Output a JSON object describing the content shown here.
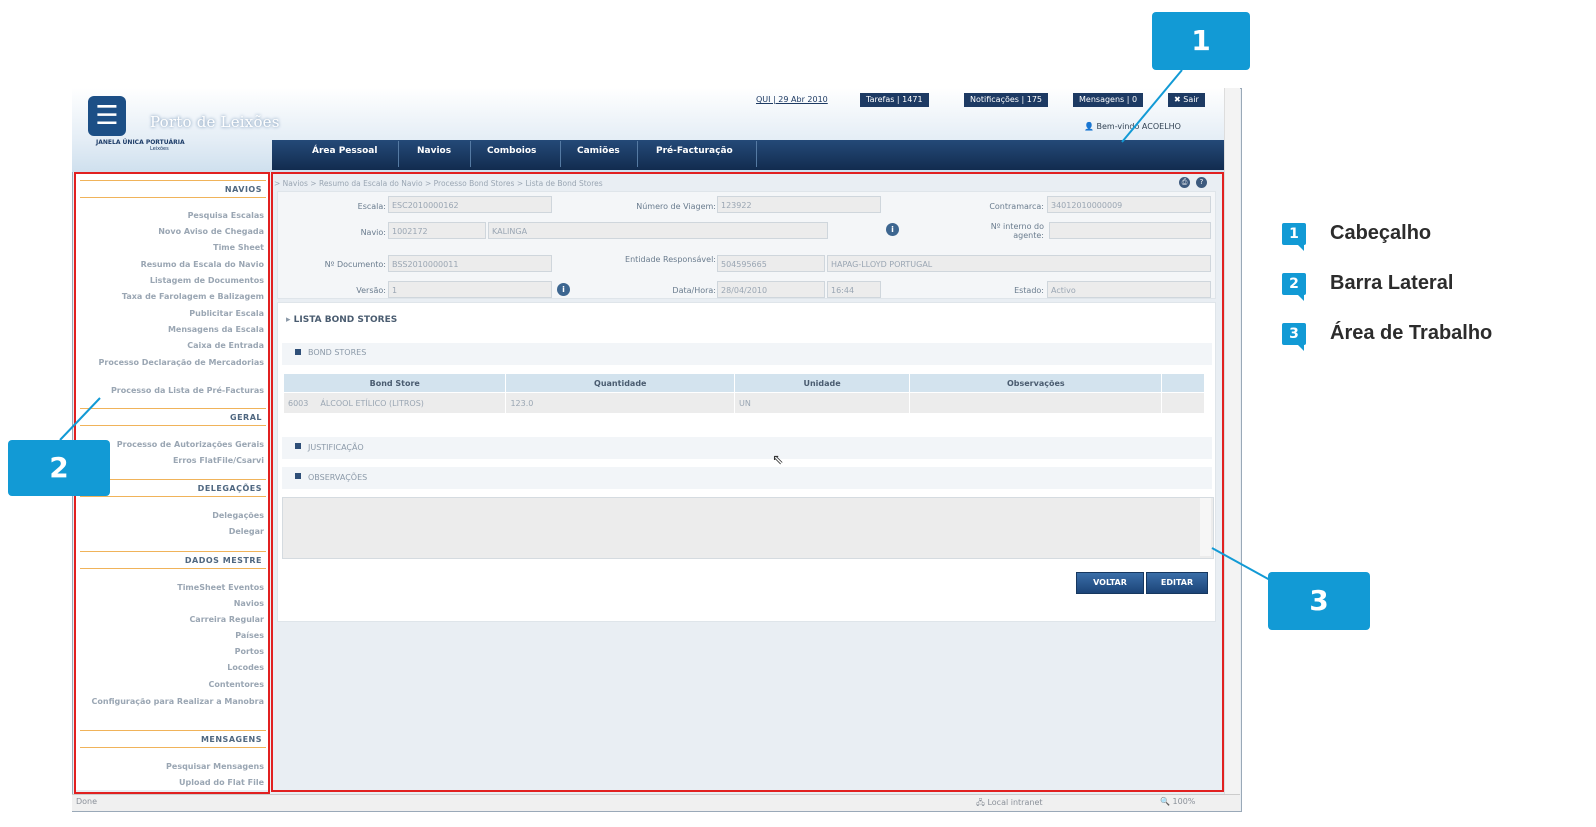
{
  "header": {
    "app_name": "Porto de Leixões",
    "app_subtitle": "JANELA ÚNICA PORTUÁRIA",
    "app_subtitle2": "Leixões",
    "date": "QUI | 29 Abr 2010",
    "tasks": "Tarefas | 1471",
    "notifications": "Notificações | 175",
    "messages": "Mensagens | 0",
    "exit": "Sair",
    "user": "Bem-vindo ACOELHO",
    "nav": [
      "Área Pessoal",
      "Navios",
      "Comboios",
      "Camiões",
      "Pré-Facturação"
    ]
  },
  "sidebar": {
    "sections": [
      {
        "title": "NAVIOS",
        "items": [
          "Pesquisa Escalas",
          "Novo Aviso de Chegada",
          "Time Sheet",
          "Resumo da Escala do Navio",
          "Listagem de Documentos",
          "Taxa de Farolagem e Balizagem",
          "Publicitar Escala",
          "Mensagens da Escala",
          "Caixa de Entrada",
          "Processo Declaração de Mercadorias",
          "Processo da Lista de Pré-Facturas"
        ]
      },
      {
        "title": "GERAL",
        "items": [
          "Processo de Autorizações Gerais",
          "Erros FlatFile/Csarvi"
        ]
      },
      {
        "title": "DELEGAÇÕES",
        "items": [
          "Delegações",
          "Delegar"
        ]
      },
      {
        "title": "DADOS MESTRE",
        "items": [
          "TimeSheet Eventos",
          "Navios",
          "Carreira Regular",
          "Países",
          "Portos",
          "Locodes",
          "Contentores",
          "Configuração para Realizar a Manobra"
        ]
      },
      {
        "title": "MENSAGENS",
        "items": [
          "Pesquisar Mensagens",
          "Upload do Flat File"
        ]
      }
    ]
  },
  "work": {
    "breadcrumb": "> Navios > Resumo da Escala do Navio > Processo Bond Stores > Lista de Bond Stores",
    "fields": {
      "escala_label": "Escala:",
      "escala": "ESC2010000162",
      "viagem_label": "Número de Viagem:",
      "viagem": "123922",
      "contramarca_label": "Contramarca:",
      "contramarca": "34012010000009",
      "navio_label": "Navio:",
      "navio_code": "1002172",
      "navio_name": "KALINGA",
      "interno_label": "Nº interno do agente:",
      "interno": "",
      "documento_label": "Nº Documento:",
      "documento": "BSS2010000011",
      "entidade_label": "Entidade Responsável:",
      "entidade_code": "504595665",
      "entidade_name": "HAPAG-LLOYD PORTUGAL",
      "versao_label": "Versão:",
      "versao": "1",
      "data_label": "Data/Hora:",
      "data": "28/04/2010",
      "hora": "16:44",
      "estado_label": "Estado:",
      "estado": "Activo"
    },
    "list_title": "LISTA BOND STORES",
    "bond_stores_title": "BOND STORES",
    "table": {
      "headers": [
        "Bond Store",
        "Quantidade",
        "Unidade",
        "Observações"
      ],
      "row": {
        "code": "6003",
        "name": "ÁLCOOL ETÍLICO (LITROS)",
        "quantidade": "123.0",
        "unidade": "UN",
        "obs": ""
      }
    },
    "justificacao_title": "JUSTIFICAÇÃO",
    "observacoes_title": "OBSERVAÇÕES",
    "btn_voltar": "VOLTAR",
    "btn_editar": "EDITAR"
  },
  "statusbar": {
    "left": "Done",
    "zone": "Local intranet",
    "zoom": "100%"
  },
  "callouts": {
    "c1": "1",
    "c2": "2",
    "c3": "3"
  },
  "legend": [
    {
      "num": "1",
      "label": "Cabeçalho"
    },
    {
      "num": "2",
      "label": "Barra Lateral"
    },
    {
      "num": "3",
      "label": "Área de Trabalho"
    }
  ],
  "colors": {
    "accent": "#129ad5",
    "highlight_box": "#e12020",
    "nav_bg": "#1d3a63"
  }
}
